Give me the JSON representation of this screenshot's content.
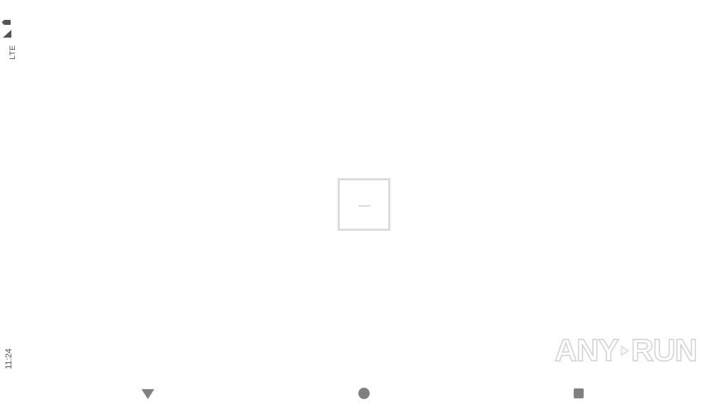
{
  "status_bar": {
    "network_label": "LTE",
    "time": "11:24",
    "icons": [
      "battery-icon",
      "signal-icon"
    ]
  },
  "center_placeholder": {
    "text": "—"
  },
  "watermark": {
    "left_text": "ANY",
    "right_text": "RUN",
    "icon": "play-icon"
  },
  "nav_bar": {
    "buttons": [
      {
        "name": "back",
        "icon": "triangle-down"
      },
      {
        "name": "home",
        "icon": "circle"
      },
      {
        "name": "recents",
        "icon": "square"
      }
    ]
  },
  "colors": {
    "background": "#ffffff",
    "status_text": "#555555",
    "nav_icons": "#808080",
    "placeholder_border": "#dcdcdc",
    "watermark_stroke": "#d0d0d0"
  }
}
